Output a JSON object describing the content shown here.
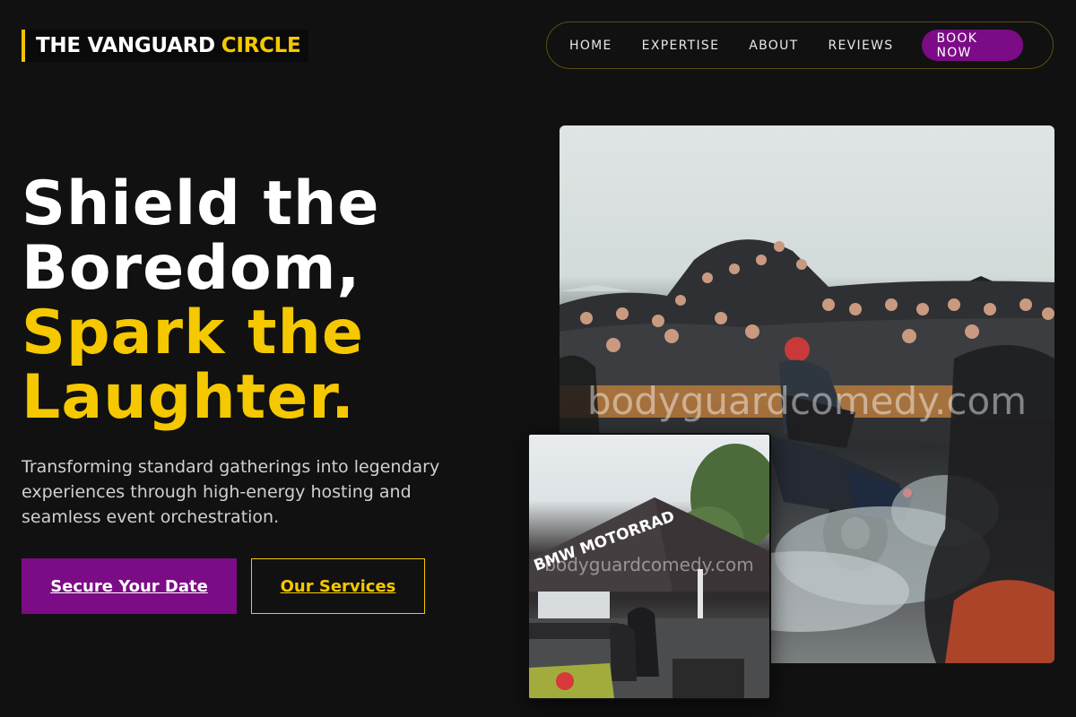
{
  "brand": {
    "name_white": "THE VANGUARD",
    "name_yellow": "CIRCLE"
  },
  "nav": {
    "items": [
      "HOME",
      "EXPERTISE",
      "ABOUT",
      "REVIEWS"
    ],
    "cta": "BOOK NOW"
  },
  "hero": {
    "line1": "Shield the",
    "line2": "Boredom,",
    "line3": "Spark the",
    "line4": "Laughter.",
    "subtitle": "Transforming standard gatherings into legendary experiences through high-energy hosting and seamless event orchestration.",
    "primary_button": "Secure Your Date",
    "secondary_button": "Our Services"
  },
  "images": {
    "main_watermark": "bodyguardcomedy.com",
    "small_watermark": "bodyguardcomedy.com",
    "tent_text": "BMW MOTORRAD"
  },
  "colors": {
    "background": "#111111",
    "accent_yellow": "#f5c800",
    "accent_purple": "#7c0b86"
  }
}
